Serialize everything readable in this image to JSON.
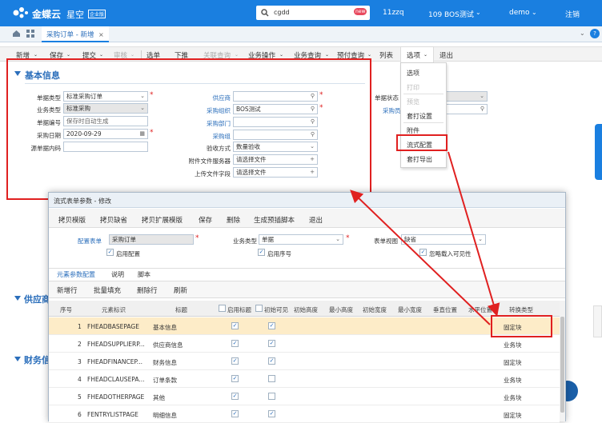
{
  "header": {
    "brand": "金蝶云",
    "product": "星空",
    "edition": "企业版",
    "search_value": "cgdd",
    "search_badge": "new",
    "org": "11zzq",
    "db": "109 BOS测试",
    "user": "demo",
    "logout": "注销"
  },
  "tabs": {
    "active": "采购订单 - 新增",
    "close": "×"
  },
  "toolbar": [
    "新增",
    "保存",
    "提交",
    "审核",
    "选单",
    "下推",
    "关联查询",
    "业务操作",
    "业务查询",
    "预付查询",
    "列表",
    "选项",
    "退出"
  ],
  "options_menu": [
    "选项",
    "打印",
    "预览",
    "套打设置",
    "附件",
    "流式配置",
    "套打导出"
  ],
  "basic": {
    "title": "基本信息",
    "fields_left": [
      {
        "label": "单据类型",
        "value": "标准采购订单"
      },
      {
        "label": "业务类型",
        "value": "标准采购"
      },
      {
        "label": "单据编号",
        "value": "保存时自动生成"
      },
      {
        "label": "采购日期",
        "value": "2020-09-29"
      },
      {
        "label": "源单据内码",
        "value": ""
      }
    ],
    "fields_mid": [
      {
        "label": "供应商",
        "value": ""
      },
      {
        "label": "采购组织",
        "value": "BOS测试"
      },
      {
        "label": "采购部门",
        "value": ""
      },
      {
        "label": "采购组",
        "value": ""
      },
      {
        "label": "验收方式",
        "value": "数量验收"
      },
      {
        "label": "附件文件服务器",
        "value": "请选择文件"
      },
      {
        "label": "上传文件字段",
        "value": "请选择文件"
      }
    ],
    "right_label": "单据状态",
    "right_label2": "采购员"
  },
  "bg_sections": {
    "s1": "供应商",
    "s2": "财务信"
  },
  "dialog": {
    "title": "流式表单参数 - 修改",
    "toolbar": [
      "拷贝模版",
      "拷贝缺省",
      "拷贝扩展模版",
      "保存",
      "删除",
      "生成预插脚本",
      "退出"
    ],
    "config_label": "配置表单",
    "config_value": "采购订单",
    "biz_label": "业务类型",
    "biz_value": "单据",
    "view_label": "表单视图",
    "view_value": "缺省",
    "enable_config": "启用配置",
    "enable_seq": "启用序号",
    "ignore_visible": "忽略载入可见性",
    "tabs": [
      "元素参数配置",
      "说明",
      "脚本"
    ],
    "subtools": [
      "新增行",
      "批量填充",
      "删除行",
      "刷新"
    ],
    "columns": [
      "序号",
      "元素标识",
      "标题",
      "启用标题",
      "初始可见",
      "初始高度",
      "最小高度",
      "初始宽度",
      "最小宽度",
      "垂直位置",
      "水平位置",
      "转换类型"
    ],
    "rows": [
      {
        "seq": "1",
        "key": "FHEADBASEPAGE",
        "title": "基本信息",
        "t": true,
        "v": true,
        "type": "固定块"
      },
      {
        "seq": "2",
        "key": "FHEADSUPPLIERP...",
        "title": "供应商信息",
        "t": true,
        "v": true,
        "type": "业务块"
      },
      {
        "seq": "3",
        "key": "FHEADFINANCEP...",
        "title": "财务信息",
        "t": true,
        "v": true,
        "type": "固定块"
      },
      {
        "seq": "4",
        "key": "FHEADCLAUSEPA...",
        "title": "订单条款",
        "t": true,
        "v": false,
        "type": "业务块"
      },
      {
        "seq": "5",
        "key": "FHEADOTHERPAGE",
        "title": "其他",
        "t": true,
        "v": false,
        "type": "业务块"
      },
      {
        "seq": "6",
        "key": "FENTRYLISTPAGE",
        "title": "明细信息",
        "t": true,
        "v": true,
        "type": "固定块"
      }
    ]
  },
  "colors": {
    "brand_blue": "#1a7fe0",
    "highlight_red": "#e02020",
    "link_blue": "#2a6ebb"
  }
}
